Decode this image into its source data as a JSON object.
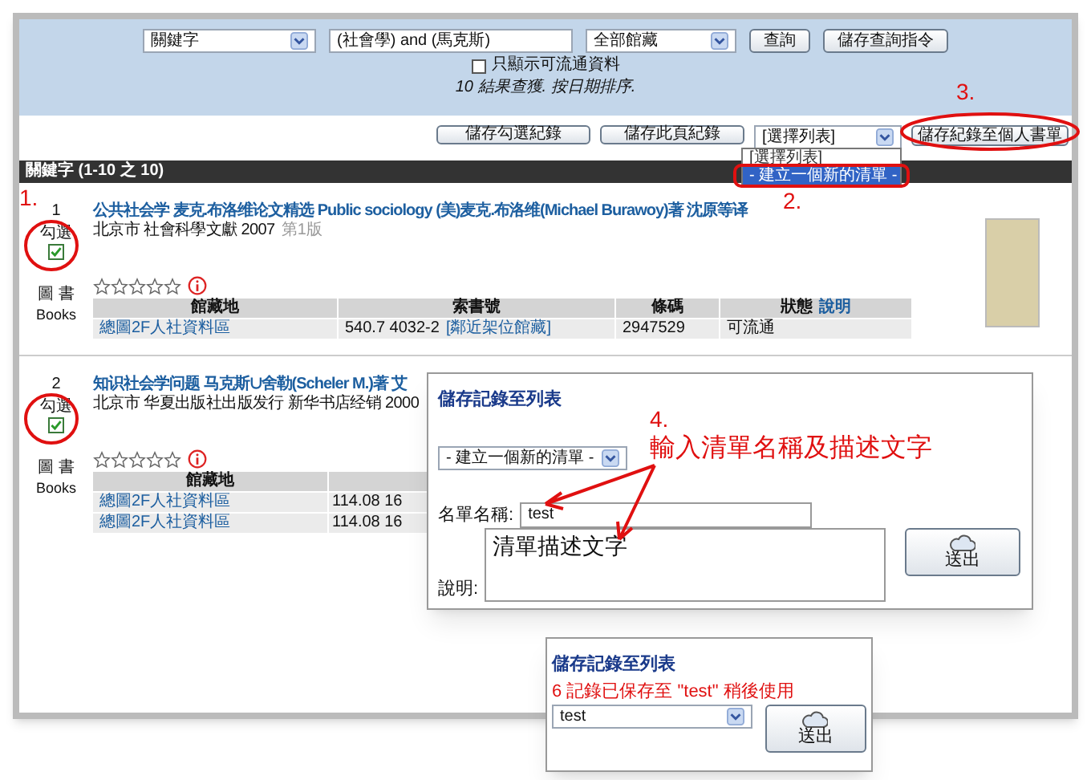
{
  "search": {
    "field_select": "關鍵字",
    "query": "(社會學) and (馬克斯)",
    "library_select": "全部館藏",
    "buttons": [
      "查詢",
      "儲存查詢指令"
    ],
    "available_only": {
      "label": "只顯示可流通資料",
      "checked": false
    },
    "summary": "10 結果查獲. 按日期排序."
  },
  "actions": {
    "buttons": [
      "儲存勾選紀錄",
      "儲存此頁紀錄"
    ],
    "list_select": "[選擇列表]",
    "save_button": "儲存紀錄至個人書單",
    "dropdown_options": [
      {
        "label": "[選擇列表]",
        "selected": false
      },
      {
        "label": "- 建立一個新的清單 -",
        "selected": true
      }
    ]
  },
  "results_header": "關鍵字 (1-10 之 10)",
  "records": [
    {
      "number": "1",
      "check_label": "勾選",
      "checked": true,
      "format": "圖 書",
      "format_en": "Books",
      "title": "公共社会学 麦克.布洛维论文精选 Public sociology (美)麦克.布洛维(Michael Burawoy)著 沈原等译",
      "publication": "北京市 社會科學文獻 2007",
      "edition": "第1版",
      "stars": 0,
      "cover": true,
      "columns": [
        "館藏地",
        "索書號",
        "條碼",
        "狀態"
      ],
      "help_link": "說明",
      "rows": [
        {
          "location": "總圖2F人社資料區",
          "call_number": "540.7 4032-2",
          "shelf_link": "[鄰近架位館藏]",
          "barcode": "2947529",
          "status": "可流通"
        }
      ]
    },
    {
      "number": "2",
      "check_label": "勾選",
      "checked": true,
      "format": "圖 書",
      "format_en": "Books",
      "title": "知识社会学问题 马克斯∪舍勒(Scheler M.)著 艾",
      "publication": "北京市 华夏出版社出版发行 新华书店经销 2000",
      "stars": 0,
      "cover": false,
      "columns": [
        "館藏地"
      ],
      "rows": [
        {
          "location": "總圖2F人社資料區",
          "call_number": "114.08 16"
        },
        {
          "location": "總圖2F人社資料區",
          "call_number": "114.08 16"
        }
      ]
    }
  ],
  "annotations": [
    {
      "number": "1."
    },
    {
      "number": "2."
    },
    {
      "number": "3."
    },
    {
      "number": "4.",
      "caption": "輸入清單名稱及描述文字"
    }
  ],
  "save_dialog": {
    "title": "儲存記錄至列表",
    "list_select": "- 建立一個新的清單 -",
    "name_label": "名單名稱:",
    "name_value": "test",
    "description_label": "說明:",
    "description_value": "清單描述文字",
    "submit": "送出"
  },
  "saved_dialog": {
    "title": "儲存記錄至列表",
    "message": "6 記錄已保存至 \"test\" 稍後使用",
    "list_select": "test",
    "submit": "送出"
  }
}
